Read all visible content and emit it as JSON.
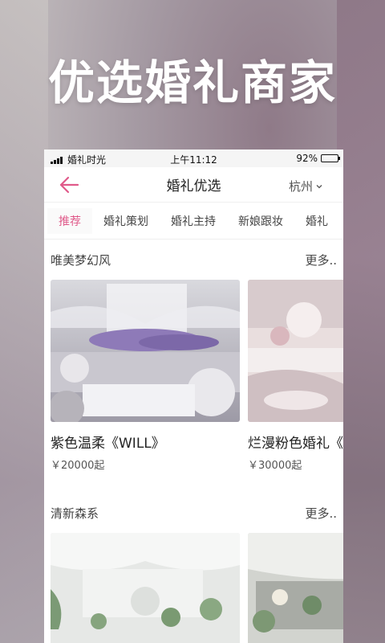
{
  "promo": {
    "headline": "优选婚礼商家"
  },
  "status_bar": {
    "carrier": "婚礼时光",
    "time": "上午11:12",
    "battery": "92%",
    "battery_level": 0.92
  },
  "nav": {
    "title": "婚礼优选",
    "city": "杭州",
    "back_icon": "arrow-left-icon",
    "city_icon": "chevron-down-icon"
  },
  "tabs": [
    {
      "label": "推荐",
      "active": true
    },
    {
      "label": "婚礼策划"
    },
    {
      "label": "婚礼主持"
    },
    {
      "label": "新娘跟妆"
    },
    {
      "label": "婚礼"
    }
  ],
  "sections": [
    {
      "title": "唯美梦幻风",
      "more": "更多..",
      "items": [
        {
          "title": "紫色温柔《WILL》",
          "price": "￥20000起"
        },
        {
          "title": "烂漫粉色婚礼《",
          "price": "￥30000起"
        }
      ]
    },
    {
      "title": "清新森系",
      "more": "更多..",
      "items": [
        {},
        {}
      ]
    }
  ],
  "colors": {
    "accent": "#e05a8a",
    "text": "#222222"
  }
}
